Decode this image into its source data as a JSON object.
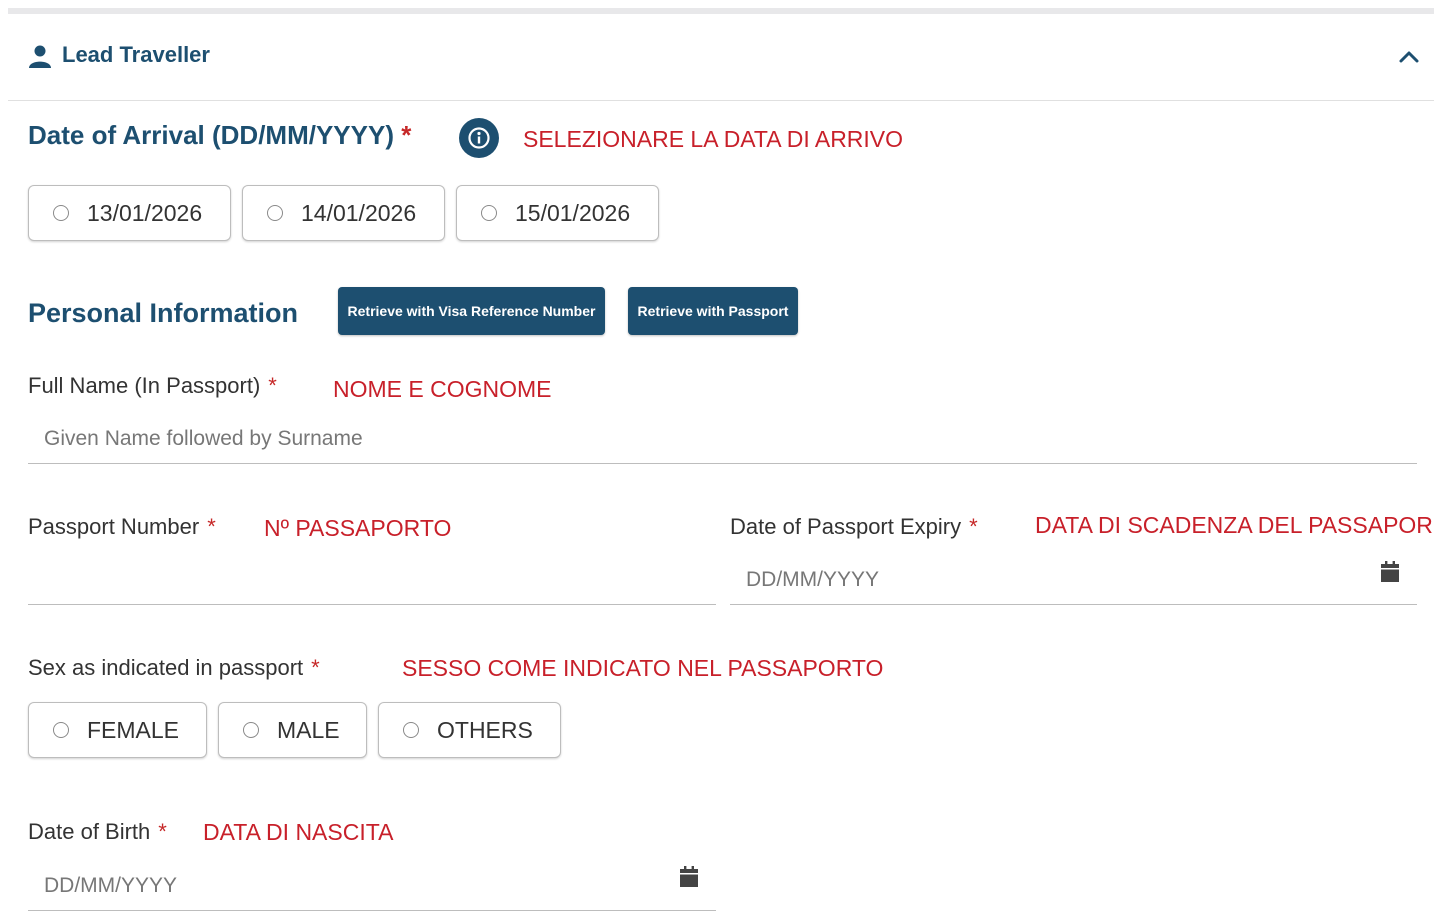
{
  "section": {
    "title": "Lead Traveller"
  },
  "arrival": {
    "label": "Date of Arrival (DD/MM/YYYY)",
    "required": "*",
    "note": "SELEZIONARE LA DATA DI ARRIVO",
    "options": [
      "13/01/2026",
      "14/01/2026",
      "15/01/2026"
    ]
  },
  "personal": {
    "title": "Personal Information",
    "retrieve_visa_label": "Retrieve with Visa Reference Number",
    "retrieve_passport_label": "Retrieve with Passport"
  },
  "full_name": {
    "label": "Full Name (In Passport)",
    "required": "*",
    "note": "NOME E COGNOME",
    "placeholder": "Given Name followed by Surname",
    "value": ""
  },
  "passport_number": {
    "label": "Passport Number",
    "required": "*",
    "note": "Nº PASSAPORTO",
    "value": ""
  },
  "passport_expiry": {
    "label": "Date of Passport Expiry",
    "required": "*",
    "note": "DATA DI SCADENZA DEL PASSAPOR",
    "placeholder": "DD/MM/YYYY",
    "value": ""
  },
  "sex": {
    "label": "Sex as indicated in passport",
    "required": "*",
    "note": "SESSO COME INDICATO NEL PASSAPORTO",
    "options": [
      "FEMALE",
      "MALE",
      "OTHERS"
    ]
  },
  "dob": {
    "label": "Date of Birth",
    "required": "*",
    "note": "DATA DI NASCITA",
    "placeholder": "DD/MM/YYYY",
    "value": ""
  },
  "icons": {
    "user": "user-icon",
    "collapse": "chevron-up-icon",
    "info": "info-icon",
    "calendar": "calendar-icon"
  },
  "colors": {
    "primary": "#1d4f70",
    "required": "#c62828",
    "annotation": "#c8202a"
  }
}
